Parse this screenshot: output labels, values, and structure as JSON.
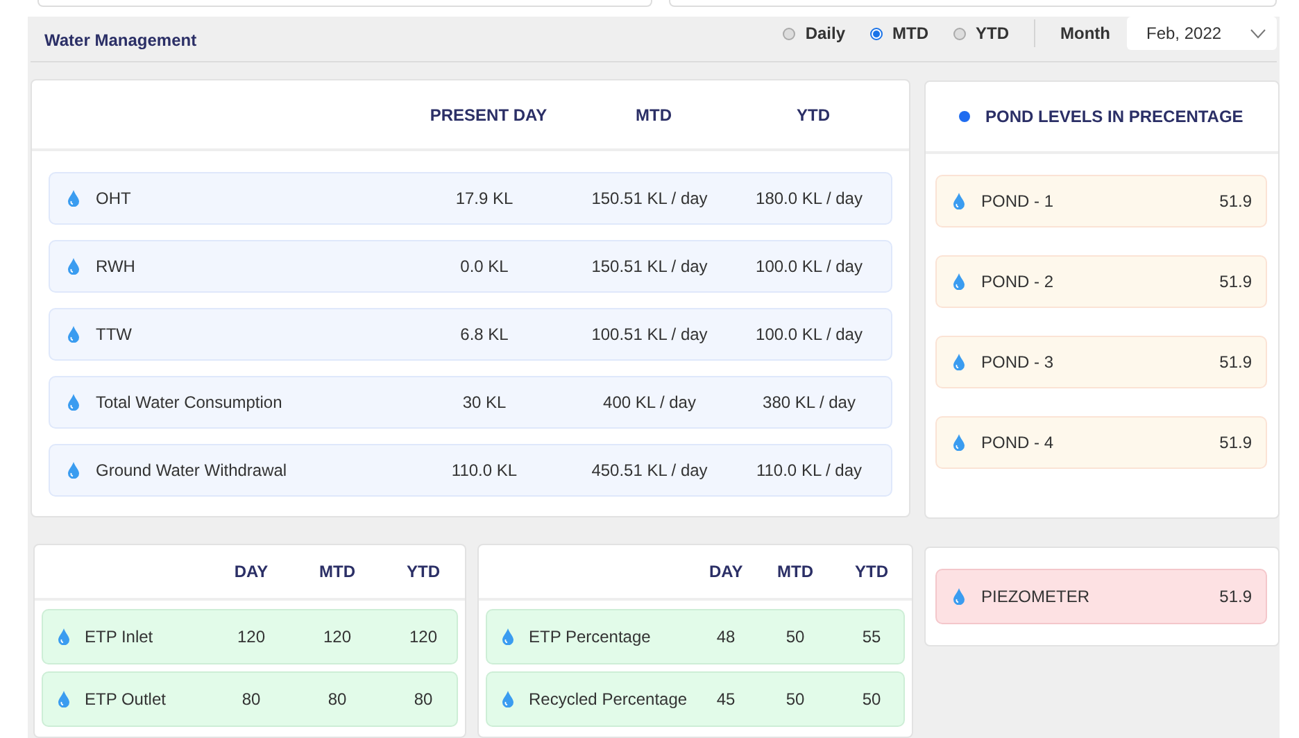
{
  "header": {
    "title": "Water Management",
    "periods": [
      {
        "label": "Daily",
        "selected": false
      },
      {
        "label": "MTD",
        "selected": true
      },
      {
        "label": "YTD",
        "selected": false
      }
    ],
    "month_label": "Month",
    "month_value": "Feb, 2022"
  },
  "consumption": {
    "columns": [
      "PRESENT DAY",
      "MTD",
      "YTD"
    ],
    "rows": [
      {
        "name": "OHT",
        "present_day": "17.9 KL",
        "mtd": "150.51 KL / day",
        "ytd": "180.0 KL / day"
      },
      {
        "name": "RWH",
        "present_day": "0.0 KL",
        "mtd": "150.51 KL / day",
        "ytd": "100.0 KL / day"
      },
      {
        "name": "TTW",
        "present_day": "6.8 KL",
        "mtd": "100.51 KL / day",
        "ytd": "100.0 KL / day"
      },
      {
        "name": "Total Water Consumption",
        "present_day": "30 KL",
        "mtd": "400 KL / day",
        "ytd": "380 KL / day"
      },
      {
        "name": "Ground Water Withdrawal",
        "present_day": "110.0 KL",
        "mtd": "450.51 KL / day",
        "ytd": "110.0 KL / day"
      }
    ]
  },
  "ponds": {
    "title": "POND LEVELS IN PRECENTAGE",
    "items": [
      {
        "name": "POND - 1",
        "value": "51.9"
      },
      {
        "name": "POND - 2",
        "value": "51.9"
      },
      {
        "name": "POND - 3",
        "value": "51.9"
      },
      {
        "name": "POND - 4",
        "value": "51.9"
      }
    ]
  },
  "etp": {
    "columns": [
      "DAY",
      "MTD",
      "YTD"
    ],
    "rows": [
      {
        "name": "ETP Inlet",
        "day": "120",
        "mtd": "120",
        "ytd": "120"
      },
      {
        "name": "ETP Outlet",
        "day": "80",
        "mtd": "80",
        "ytd": "80"
      }
    ]
  },
  "recycling": {
    "columns": [
      "DAY",
      "MTD",
      "YTD"
    ],
    "rows": [
      {
        "name": "ETP Percentage",
        "day": "48",
        "mtd": "50",
        "ytd": "55"
      },
      {
        "name": "Recycled Percentage",
        "day": "45",
        "mtd": "50",
        "ytd": "50"
      }
    ]
  },
  "piezometer": {
    "name": "PIEZOMETER",
    "value": "51.9"
  }
}
